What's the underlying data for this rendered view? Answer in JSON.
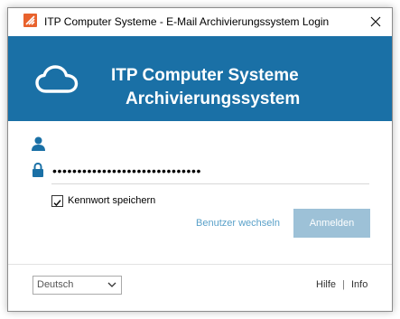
{
  "window": {
    "title": "ITP Computer Systeme - E-Mail Archivierungssystem Login"
  },
  "icons": {
    "app": "itp-app-icon",
    "close": "close-icon",
    "logo": "cloud-icon",
    "user": "user-icon",
    "lock": "lock-icon",
    "checkbox": "checkmark-icon",
    "dropdown": "chevron-down-icon"
  },
  "banner": {
    "line1": "ITP Computer Systeme",
    "line2": "Archivierungssystem"
  },
  "login": {
    "username": "",
    "password_masked": "••••••••••••••••••••••••••••••",
    "remember_label": "Kennwort speichern",
    "remember_checked": true,
    "switch_user_label": "Benutzer wechseln",
    "login_button_label": "Anmelden"
  },
  "footer": {
    "language_selected": "Deutsch",
    "help_label": "Hilfe",
    "separator": "|",
    "info_label": "Info"
  },
  "colors": {
    "banner": "#1a70a6",
    "accent_icon": "#1a70a6",
    "login_button": "#9dc1d7",
    "switch_user_link": "#5aa1c9",
    "app_icon": "#e8622d"
  }
}
